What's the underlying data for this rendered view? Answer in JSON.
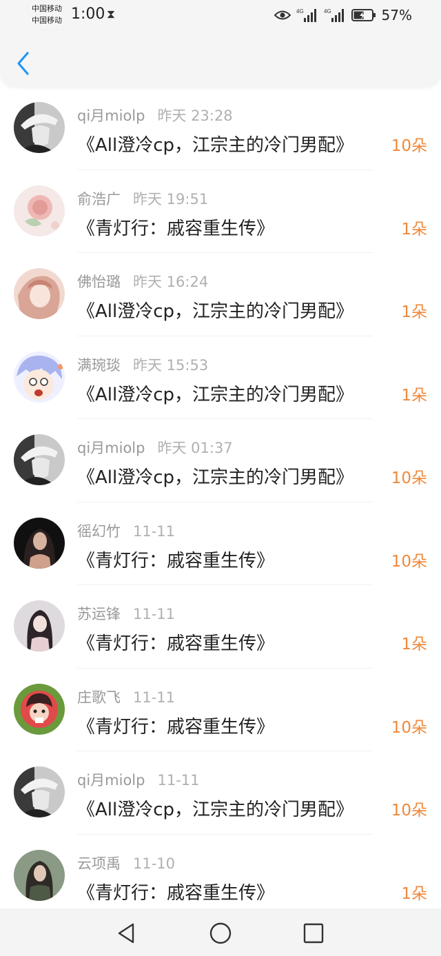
{
  "status_bar": {
    "carrier_1": "中国移动",
    "carrier_2": "中国移动",
    "time": "1:00",
    "net_1": "4G",
    "net_2": "4G",
    "battery_percent": "57%",
    "battery_level": 0.57
  },
  "header": {
    "back_icon": "chevron-left-icon",
    "accent_color": "#2196f3"
  },
  "gifts": [
    {
      "user": "qi月miolp",
      "time": "昨天 23:28",
      "title": "《All澄冷cp，江宗主的冷门男配》",
      "count": "10朵"
    },
    {
      "user": "俞浩广",
      "time": "昨天 19:51",
      "title": "《青灯行：戚容重生传》",
      "count": "1朵"
    },
    {
      "user": "佛怡璐",
      "time": "昨天 16:24",
      "title": "《All澄冷cp，江宗主的冷门男配》",
      "count": "1朵"
    },
    {
      "user": "满琬琰",
      "time": "昨天 15:53",
      "title": "《All澄冷cp，江宗主的冷门男配》",
      "count": "1朵"
    },
    {
      "user": "qi月miolp",
      "time": "昨天 01:37",
      "title": "《All澄冷cp，江宗主的冷门男配》",
      "count": "10朵"
    },
    {
      "user": "徭幻竹",
      "time": "11-11",
      "title": "《青灯行：戚容重生传》",
      "count": "10朵"
    },
    {
      "user": "苏运锋",
      "time": "11-11",
      "title": "《青灯行：戚容重生传》",
      "count": "1朵"
    },
    {
      "user": "庄歌飞",
      "time": "11-11",
      "title": "《青灯行：戚容重生传》",
      "count": "10朵"
    },
    {
      "user": "qi月miolp",
      "time": "11-11",
      "title": "《All澄冷cp，江宗主的冷门男配》",
      "count": "10朵"
    },
    {
      "user": "云项禹",
      "time": "11-10",
      "title": "《青灯行：戚容重生传》",
      "count": "1朵"
    }
  ],
  "colors": {
    "count": "#f0883a",
    "username": "#999999",
    "title": "#222222"
  },
  "nav": {
    "back_icon": "triangle-back-icon",
    "home_icon": "circle-home-icon",
    "recents_icon": "square-recents-icon"
  }
}
